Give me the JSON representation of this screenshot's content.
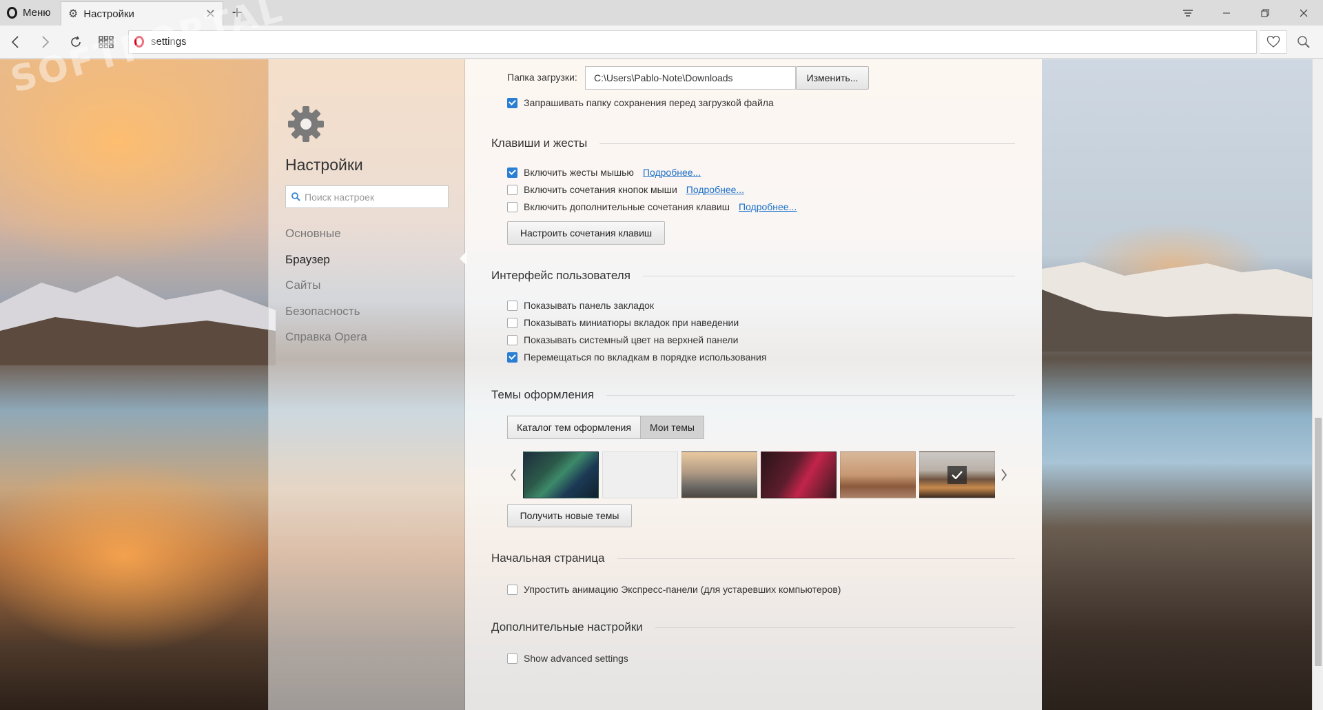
{
  "tabbar": {
    "menu_label": "Меню",
    "tab_title": "Настройки"
  },
  "address": {
    "url": "settings"
  },
  "watermark": {
    "text": "SOFTPORTAL"
  },
  "sidebar": {
    "title": "Настройки",
    "search_placeholder": "Поиск настроек",
    "items": [
      {
        "label": "Основные",
        "active": false
      },
      {
        "label": "Браузер",
        "active": true
      },
      {
        "label": "Сайты",
        "active": false
      },
      {
        "label": "Безопасность",
        "active": false
      },
      {
        "label": "Справка Opera",
        "active": false
      }
    ]
  },
  "download": {
    "label": "Папка загрузки:",
    "path": "C:\\Users\\Pablo-Note\\Downloads",
    "change_button": "Изменить...",
    "ask_label": "Запрашивать папку сохранения перед загрузкой файла",
    "ask_checked": true
  },
  "shortcuts": {
    "heading": "Клавиши и жесты",
    "mouse_gestures": {
      "label": "Включить жесты мышью",
      "link": "Подробнее...",
      "checked": true
    },
    "rocker": {
      "label": "Включить сочетания кнопок мыши",
      "link": "Подробнее...",
      "checked": false
    },
    "advanced_keys": {
      "label": "Включить дополнительные сочетания клавиш",
      "link": "Подробнее...",
      "checked": false
    },
    "configure_button": "Настроить сочетания клавиш"
  },
  "ui": {
    "heading": "Интерфейс пользователя",
    "bookmarks_bar": {
      "label": "Показывать панель закладок",
      "checked": false
    },
    "tab_thumbnails": {
      "label": "Показывать миниатюры вкладок при наведении",
      "checked": false
    },
    "system_color": {
      "label": "Показывать системный цвет на верхней панели",
      "checked": false
    },
    "tab_cycling": {
      "label": "Перемещаться по вкладкам в порядке использования",
      "checked": true
    }
  },
  "themes": {
    "heading": "Темы оформления",
    "catalog_button": "Каталог тем оформления",
    "my_themes_button": "Мои темы",
    "get_new_button": "Получить новые темы",
    "selected_index": 5
  },
  "startpage": {
    "heading": "Начальная страница",
    "simplify": {
      "label": "Упростить анимацию Экспресс-панели (для устаревших компьютеров)",
      "checked": false
    }
  },
  "advanced": {
    "heading": "Дополнительные настройки",
    "show": {
      "label": "Show advanced settings",
      "checked": false
    }
  },
  "colors": {
    "accent": "#2a7fd4",
    "link": "#1a6fc9",
    "opera_red": "#e0001b"
  }
}
